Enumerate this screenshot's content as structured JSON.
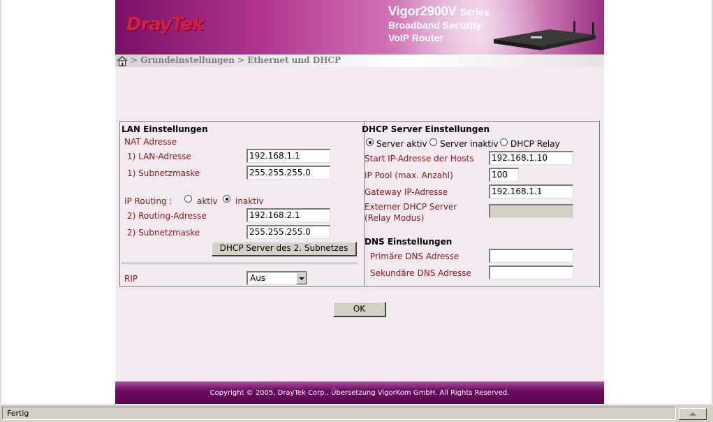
{
  "banner": {
    "logo": "DrayTek",
    "model": "Vigor2900V",
    "series": "Series",
    "tagline1": "Broadband Security",
    "tagline2": "VoIP Router"
  },
  "breadcrumb": "> Grundeinstellungen > Ethernet und DHCP",
  "lan": {
    "title": "LAN Einstellungen",
    "nat_title": "NAT Adresse",
    "lan_address_label": "1) LAN-Adresse",
    "lan_address_value": "192.168.1.1",
    "subnet1_label": "1) Subnetzmaske",
    "subnet1_value": "255.255.255.0",
    "ip_routing_label": "IP Routing :",
    "ip_routing_on": "aktiv",
    "ip_routing_off": "inaktiv",
    "ip_routing_selected": "inaktiv",
    "routing_address_label": "2) Routing-Adresse",
    "routing_address_value": "192.168.2.1",
    "subnet2_label": "2) Subnetzmaske",
    "subnet2_value": "255.255.255.0",
    "dhcp2_button": "DHCP Server des 2. Subnetzes",
    "rip_label": "RIP",
    "rip_value": "Aus"
  },
  "dhcp": {
    "title": "DHCP Server Einstellungen",
    "mode_active": "Server aktiv",
    "mode_inactive": "Server inaktiv",
    "mode_relay": "DHCP Relay",
    "mode_selected": "Server aktiv",
    "start_ip_label": "Start IP-Adresse der Hosts",
    "start_ip_value": "192.168.1.10",
    "pool_label": "IP Pool (max. Anzahl)",
    "pool_value": "100",
    "gateway_label": "Gateway IP-Adresse",
    "gateway_value": "192.168.1.1",
    "external_label1": "Externer DHCP Server",
    "external_label2": "(Relay Modus)",
    "external_value": ""
  },
  "dns": {
    "title": "DNS Einstellungen",
    "primary_label": "Primäre DNS Adresse",
    "primary_value": "",
    "secondary_label": "Sekundäre DNS Adresse",
    "secondary_value": ""
  },
  "ok_button": "OK",
  "footer": "Copyright © 2005, DrayTek Corp., Übersetzung VigorKom GmbH. All Rights Reserved.",
  "statusbar": {
    "text": "Fertig"
  },
  "colors": {
    "brand_purple": "#7a1066",
    "label_red": "#8b1a1a",
    "logo_red": "#d41f3c"
  }
}
